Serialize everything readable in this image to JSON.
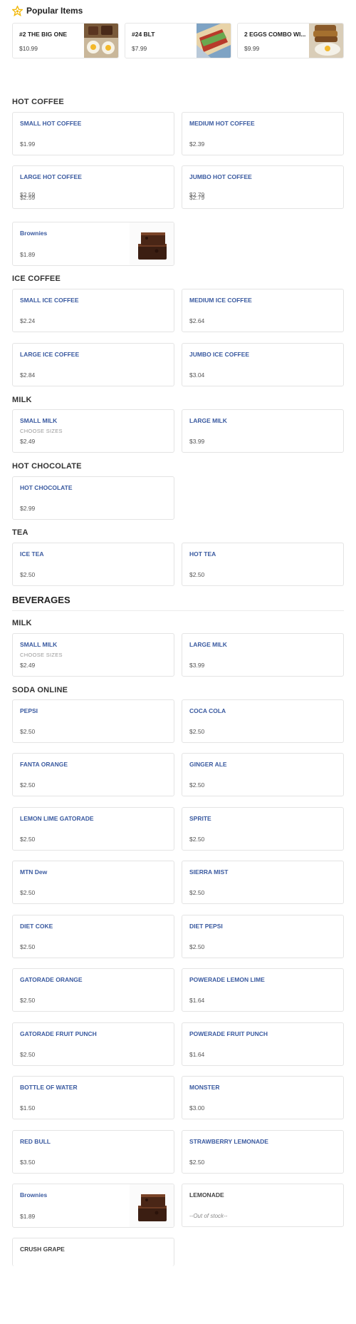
{
  "popular": {
    "title": "Popular Items",
    "items": [
      {
        "name": "#2 THE BIG ONE",
        "price": "$10.99",
        "image": "eggs-bacon-plate"
      },
      {
        "name": "#24 BLT",
        "price": "$7.99",
        "image": "blt-sandwich"
      },
      {
        "name": "2 EGGS COMBO WI...",
        "price": "$9.99",
        "image": "eggs-combo-plate"
      }
    ]
  },
  "hot_coffee": {
    "title": "HOT COFFEE",
    "items": [
      {
        "name": "SMALL HOT COFFEE",
        "price": "$1.99"
      },
      {
        "name": "MEDIUM HOT COFFEE",
        "price": "$2.39"
      },
      {
        "name": "LARGE HOT COFFEE",
        "price_a": "$2.59",
        "price_b": "$2.59"
      },
      {
        "name": "JUMBO HOT COFFEE",
        "price_a": "$2.79",
        "price_b": "$2.79"
      },
      {
        "name": "Brownies",
        "price": "$1.89",
        "image": "brownies"
      }
    ]
  },
  "ice_coffee": {
    "title": "ICE COFFEE",
    "items": [
      {
        "name": "SMALL ICE COFFEE",
        "price": "$2.24"
      },
      {
        "name": "MEDIUM ICE COFFEE",
        "price": "$2.64"
      },
      {
        "name": "LARGE ICE COFFEE",
        "price": "$2.84"
      },
      {
        "name": "JUMBO ICE COFFEE",
        "price": "$3.04"
      }
    ]
  },
  "milk1": {
    "title": "MILK",
    "items": [
      {
        "name": "SMALL MILK",
        "sub": "CHOOSE SIZES",
        "price": "$2.49"
      },
      {
        "name": "LARGE MILK",
        "price": "$3.99"
      }
    ]
  },
  "hot_chocolate": {
    "title": "HOT CHOCOLATE",
    "items": [
      {
        "name": "HOT CHOCOLATE",
        "price": "$2.99"
      }
    ]
  },
  "tea": {
    "title": "TEA",
    "items": [
      {
        "name": "ICE TEA",
        "price": "$2.50"
      },
      {
        "name": "HOT TEA",
        "price": "$2.50"
      }
    ]
  },
  "beverages": {
    "title": "BEVERAGES"
  },
  "milk2": {
    "title": "MILK",
    "items": [
      {
        "name": "SMALL MILK",
        "sub": "CHOOSE SIZES",
        "price": "$2.49"
      },
      {
        "name": "LARGE MILK",
        "price": "$3.99"
      }
    ]
  },
  "soda": {
    "title": "SODA ONLINE",
    "items": [
      {
        "name": "PEPSI",
        "price": "$2.50"
      },
      {
        "name": "COCA COLA",
        "price": "$2.50"
      },
      {
        "name": "FANTA ORANGE",
        "price": "$2.50"
      },
      {
        "name": "GINGER ALE",
        "price": "$2.50"
      },
      {
        "name": "LEMON LIME GATORADE",
        "price": "$2.50"
      },
      {
        "name": "SPRITE",
        "price": "$2.50"
      },
      {
        "name": "MTN Dew",
        "price": "$2.50"
      },
      {
        "name": "SIERRA MIST",
        "price": "$2.50"
      },
      {
        "name": "DIET COKE",
        "price": "$2.50"
      },
      {
        "name": "DIET PEPSI",
        "price": "$2.50"
      },
      {
        "name": "GATORADE ORANGE",
        "price": "$2.50"
      },
      {
        "name": "POWERADE LEMON LIME",
        "price": "$1.64"
      },
      {
        "name": "GATORADE FRUIT PUNCH",
        "price": "$2.50"
      },
      {
        "name": "POWERADE FRUIT PUNCH",
        "price": "$1.64"
      },
      {
        "name": "BOTTLE OF WATER",
        "price": "$1.50"
      },
      {
        "name": "MONSTER",
        "price": "$3.00"
      },
      {
        "name": "RED BULL",
        "price": "$3.50"
      },
      {
        "name": "STRAWBERRY LEMONADE",
        "price": "$2.50"
      },
      {
        "name": "Brownies",
        "price": "$1.89",
        "image": "brownies"
      },
      {
        "name": "LEMONADE",
        "status": "--Out of stock--"
      },
      {
        "name": "CRUSH GRAPE"
      }
    ]
  },
  "colors": {
    "accent": "#3a5aa0",
    "border": "#e4e4e4",
    "star": "#f2b705"
  }
}
